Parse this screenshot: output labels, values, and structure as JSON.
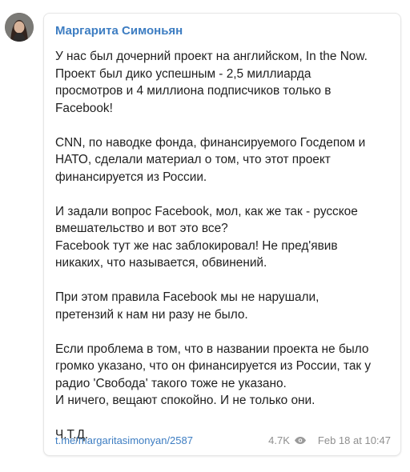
{
  "post": {
    "author": "Маргарита Симоньян",
    "paragraphs": [
      "У нас был дочерний проект на английском, In the Now.\nПроект был дико успешным - 2,5 миллиарда\nпросмотров и 4 миллиона подписчиков только в\nFacebook!",
      "CNN, по наводке фонда, финансируемого Госдепом и\nНАТО, сделали материал о том, что этот проект\nфинансируется из России.",
      "И задали вопрос Facebook, мол, как же так - русское\nвмешательство и вот это все?\nFacebook тут же нас заблокировал! Не пред'явив\nникаких, что называется, обвинений.",
      "При этом правила Facebook мы не нарушали,\nпретензий к нам ни разу не было.",
      "Если проблема в том, что в названии проекта не было\nгромко указано, что он финансируется из России, так у\nрадио 'Свобода' такого тоже не указано.\nИ ничего, вещают спокойно. И не только они.",
      "Ч.Т.Д."
    ],
    "link": "t.me/margaritasimonyan/2587",
    "views": "4.7K",
    "date": "Feb 18 at 10:47"
  },
  "icons": {
    "views": "eye-icon"
  },
  "colors": {
    "accent": "#3d7dc2",
    "text": "#1f1f1f",
    "meta": "#8f8f8f"
  }
}
